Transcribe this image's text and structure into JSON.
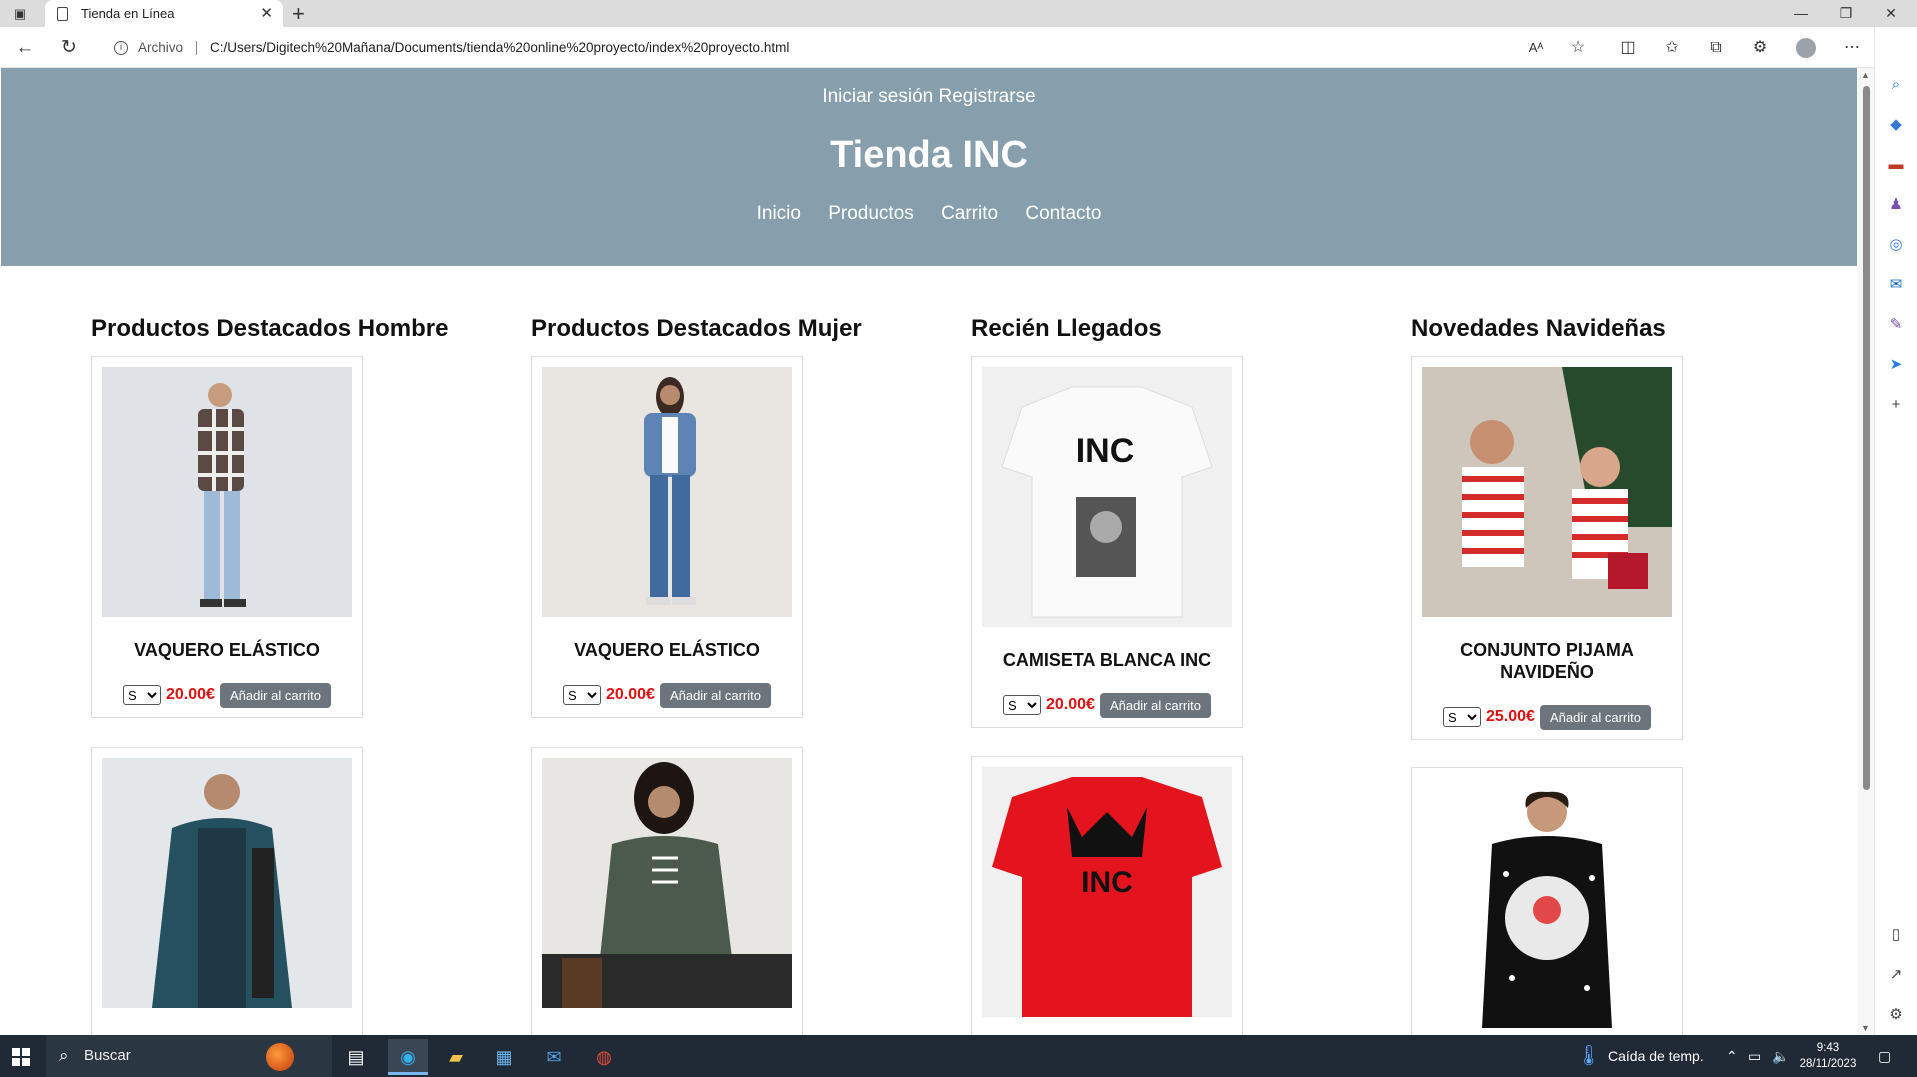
{
  "browser": {
    "tab_title": "Tienda en Línea",
    "tab_close": "✕",
    "new_tab": "+",
    "url_scheme_label": "Archivo",
    "url": "C:/Users/Digitech%20Mañana/Documents/tienda%20online%20proyecto/index%20proyecto.html"
  },
  "site": {
    "auth": {
      "login": "Iniciar sesión",
      "register": "Registrarse"
    },
    "title": "Tienda INC",
    "nav": [
      "Inicio",
      "Productos",
      "Carrito",
      "Contacto"
    ]
  },
  "sections": [
    {
      "title": "Productos Destacados Hombre",
      "products": [
        {
          "name": "VAQUERO ELÁSTICO",
          "size": "S",
          "price": "20.00€",
          "button": "Añadir al carrito"
        },
        {
          "name": "",
          "size": "",
          "price": "",
          "button": ""
        }
      ]
    },
    {
      "title": "Productos Destacados Mujer",
      "products": [
        {
          "name": "VAQUERO ELÁSTICO",
          "size": "S",
          "price": "20.00€",
          "button": "Añadir al carrito"
        },
        {
          "name": "",
          "size": "",
          "price": "",
          "button": ""
        }
      ]
    },
    {
      "title": "Recién Llegados",
      "products": [
        {
          "name": "CAMISETA BLANCA INC",
          "size": "S",
          "price": "20.00€",
          "button": "Añadir al carrito",
          "print_text": "INC"
        },
        {
          "name": "",
          "size": "",
          "price": "",
          "button": "",
          "print_text": "INC"
        }
      ]
    },
    {
      "title": "Novedades Navideñas",
      "products": [
        {
          "name": "CONJUNTO PIJAMA NAVIDEÑO",
          "size": "S",
          "price": "25.00€",
          "button": "Añadir al carrito"
        },
        {
          "name": "",
          "size": "",
          "price": "",
          "button": ""
        }
      ]
    }
  ],
  "taskbar": {
    "search_placeholder": "Buscar",
    "weather": "Caída de temp.",
    "time": "9:43",
    "date": "28/11/2023"
  },
  "colors": {
    "header_bg": "#879fad",
    "price": "#dd1111",
    "button_bg": "#6c757d",
    "taskbar_bg": "#1f2a36"
  }
}
